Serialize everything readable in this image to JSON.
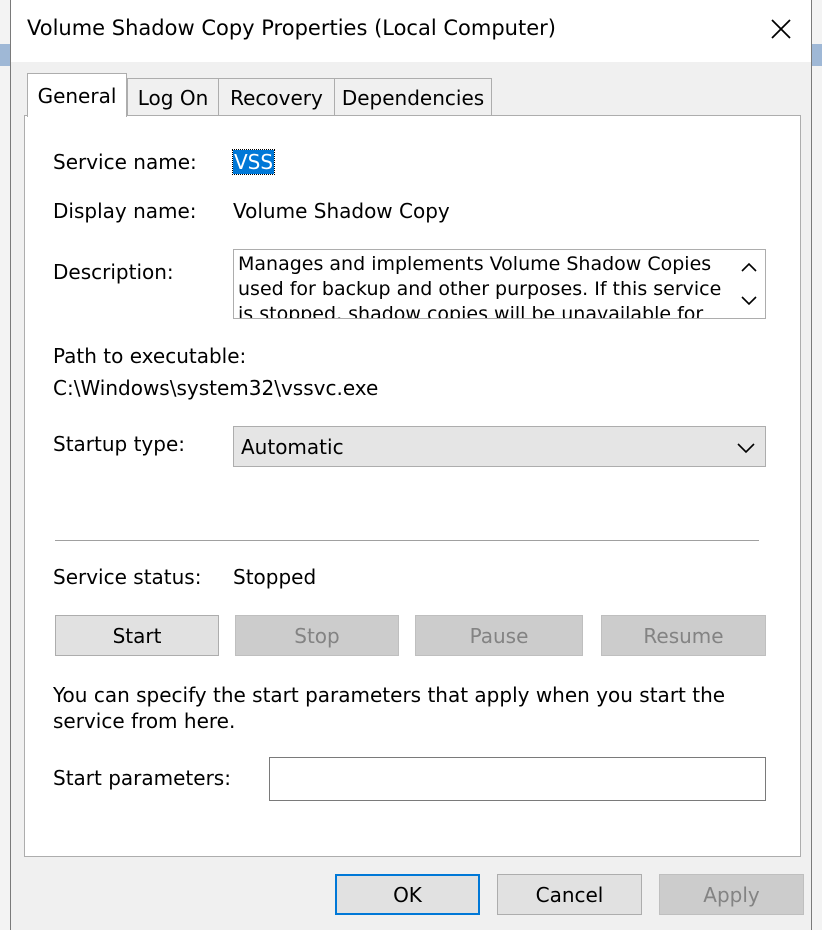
{
  "window": {
    "title": "Volume Shadow Copy Properties (Local Computer)"
  },
  "tabs": [
    {
      "label": "General",
      "active": true
    },
    {
      "label": "Log On",
      "active": false
    },
    {
      "label": "Recovery",
      "active": false
    },
    {
      "label": "Dependencies",
      "active": false
    }
  ],
  "general": {
    "service_name_label": "Service name:",
    "service_name_value": "VSS",
    "display_name_label": "Display name:",
    "display_name_value": "Volume Shadow Copy",
    "description_label": "Description:",
    "description_value": "Manages and implements Volume Shadow Copies used for backup and other purposes. If this service is stopped, shadow copies will be unavailable for",
    "path_label": "Path to executable:",
    "path_value": "C:\\Windows\\system32\\vssvc.exe",
    "startup_type_label": "Startup type:",
    "startup_type_value": "Automatic",
    "service_status_label": "Service status:",
    "service_status_value": "Stopped",
    "start_button": "Start",
    "stop_button": "Stop",
    "pause_button": "Pause",
    "resume_button": "Resume",
    "info_text": "You can specify the start parameters that apply when you start the service from here.",
    "start_params_label": "Start parameters:",
    "start_params_value": ""
  },
  "footer": {
    "ok_button": "OK",
    "cancel_button": "Cancel",
    "apply_button": "Apply"
  },
  "icons": {
    "close": "close-icon",
    "scroll_up": "chevron-up-icon",
    "scroll_down": "chevron-down-icon",
    "dropdown": "chevron-down-icon"
  },
  "colors": {
    "selection": "#0078d7",
    "dialog_bg": "#f0f0f0",
    "panel_bg": "#ffffff",
    "disabled_text": "#838383"
  }
}
